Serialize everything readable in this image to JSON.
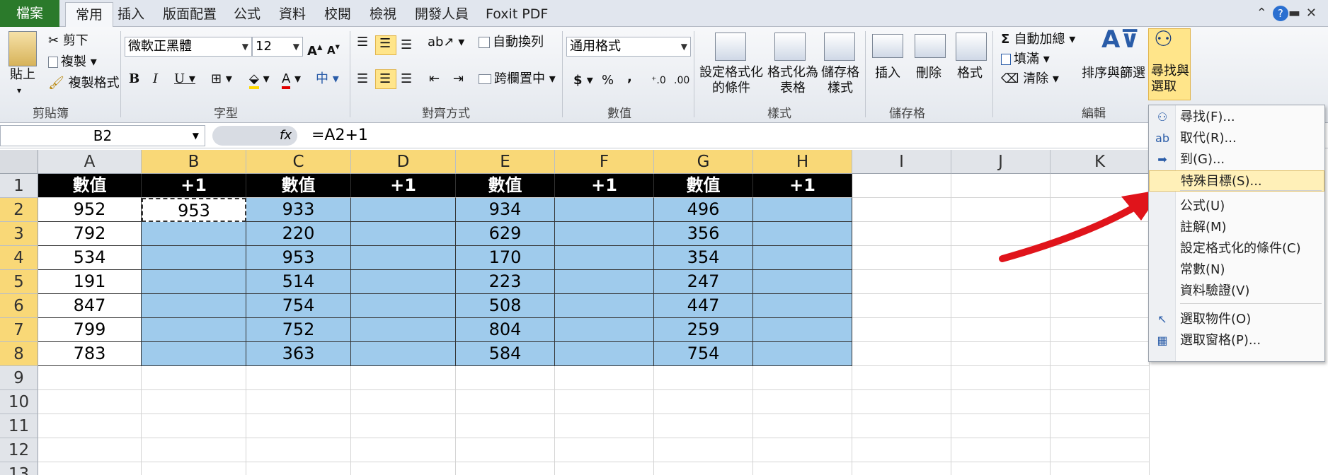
{
  "ribbon_tabs": [
    "檔案",
    "常用",
    "插入",
    "版面配置",
    "公式",
    "資料",
    "校閱",
    "檢視",
    "開發人員",
    "Foxit PDF"
  ],
  "clipboard": {
    "paste": "貼上",
    "cut": "剪下",
    "copy": "複製",
    "format_painter": "複製格式",
    "label": "剪貼簿"
  },
  "font": {
    "name": "微軟正黑體",
    "size": "12",
    "label": "字型"
  },
  "alignment": {
    "wrap": "自動換列",
    "merge": "跨欄置中",
    "label": "對齊方式"
  },
  "number": {
    "format": "通用格式",
    "label": "數值",
    "currency": "$",
    "percent": "%",
    "comma": ","
  },
  "styles": {
    "conditional": "設定格式化\n的條件",
    "table": "格式化為\n表格",
    "cell": "儲存格\n樣式",
    "label": "樣式"
  },
  "cells": {
    "insert": "插入",
    "delete": "刪除",
    "format": "格式",
    "label": "儲存格"
  },
  "editing": {
    "autosum": "自動加總",
    "fill": "填滿",
    "clear": "清除",
    "sort": "排序與篩選",
    "find": "尋找與\n選取",
    "label": "編輯"
  },
  "formula_bar": {
    "name_box": "B2",
    "fx": "fx",
    "formula": "=A2+1"
  },
  "columns": [
    "A",
    "B",
    "C",
    "D",
    "E",
    "F",
    "G",
    "H",
    "I",
    "J",
    "K"
  ],
  "rows": [
    "1",
    "2",
    "3",
    "4",
    "5",
    "6",
    "7",
    "8",
    "9",
    "10",
    "11",
    "12",
    "13"
  ],
  "header_row": [
    "數值",
    "+1",
    "數值",
    "+1",
    "數值",
    "+1",
    "數值",
    "+1"
  ],
  "data": [
    [
      "952",
      "953",
      "933",
      "",
      "934",
      "",
      "496",
      ""
    ],
    [
      "792",
      "",
      "220",
      "",
      "629",
      "",
      "356",
      ""
    ],
    [
      "534",
      "",
      "953",
      "",
      "170",
      "",
      "354",
      ""
    ],
    [
      "191",
      "",
      "514",
      "",
      "223",
      "",
      "247",
      ""
    ],
    [
      "847",
      "",
      "754",
      "",
      "508",
      "",
      "447",
      ""
    ],
    [
      "799",
      "",
      "752",
      "",
      "804",
      "",
      "259",
      ""
    ],
    [
      "783",
      "",
      "363",
      "",
      "584",
      "",
      "754",
      ""
    ]
  ],
  "menu_items": [
    {
      "label": "尋找(F)...",
      "icon": "binoculars-icon"
    },
    {
      "label": "取代(R)...",
      "icon": "replace-icon"
    },
    {
      "label": "到(G)...",
      "icon": "arrow-right-icon"
    },
    {
      "label": "特殊目標(S)...",
      "icon": ""
    },
    {
      "label": "公式(U)",
      "icon": ""
    },
    {
      "label": "註解(M)",
      "icon": ""
    },
    {
      "label": "設定格式化的條件(C)",
      "icon": ""
    },
    {
      "label": "常數(N)",
      "icon": ""
    },
    {
      "label": "資料驗證(V)",
      "icon": ""
    },
    {
      "label": "選取物件(O)",
      "icon": "cursor-icon"
    },
    {
      "label": "選取窗格(P)...",
      "icon": "selection-pane-icon"
    }
  ],
  "colors": {
    "accent": "#2b7a2b",
    "selected_header": "#f9d877",
    "selection": "#9fcbec",
    "arrow": "#e0141b"
  }
}
